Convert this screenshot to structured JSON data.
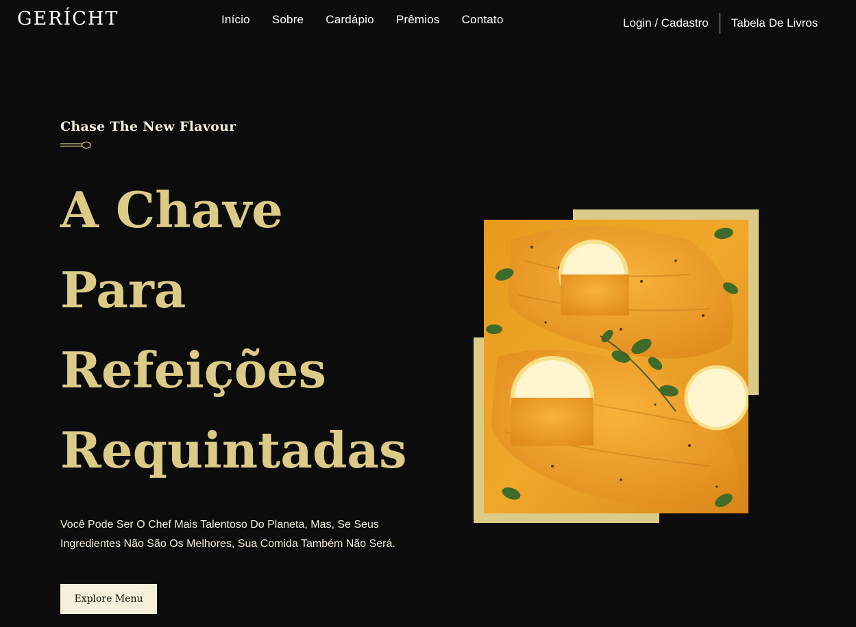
{
  "brand": {
    "logo": "GERÍCHT"
  },
  "nav": {
    "links": [
      "Início",
      "Sobre",
      "Cardápio",
      "Prêmios",
      "Contato"
    ],
    "login": "Login / Cadastro",
    "book_table": "Tabela De Livros"
  },
  "hero": {
    "subtitle": "Chase The New Flavour",
    "title_lines": [
      "A Chave",
      "Para",
      "Refeições",
      "Requintadas"
    ],
    "description": "Você Pode Ser O Chef Mais Talentoso Do Planeta, Mas, Se Seus Ingredientes Não São Os Melhores, Sua Comida Também Não Será.",
    "cta": "Explore Menu"
  },
  "colors": {
    "background": "#0c0c0c",
    "gold": "#dcca87",
    "cream": "#f5efdb",
    "white": "#ffffff"
  },
  "icons": {
    "spoon": "spoon-icon"
  }
}
